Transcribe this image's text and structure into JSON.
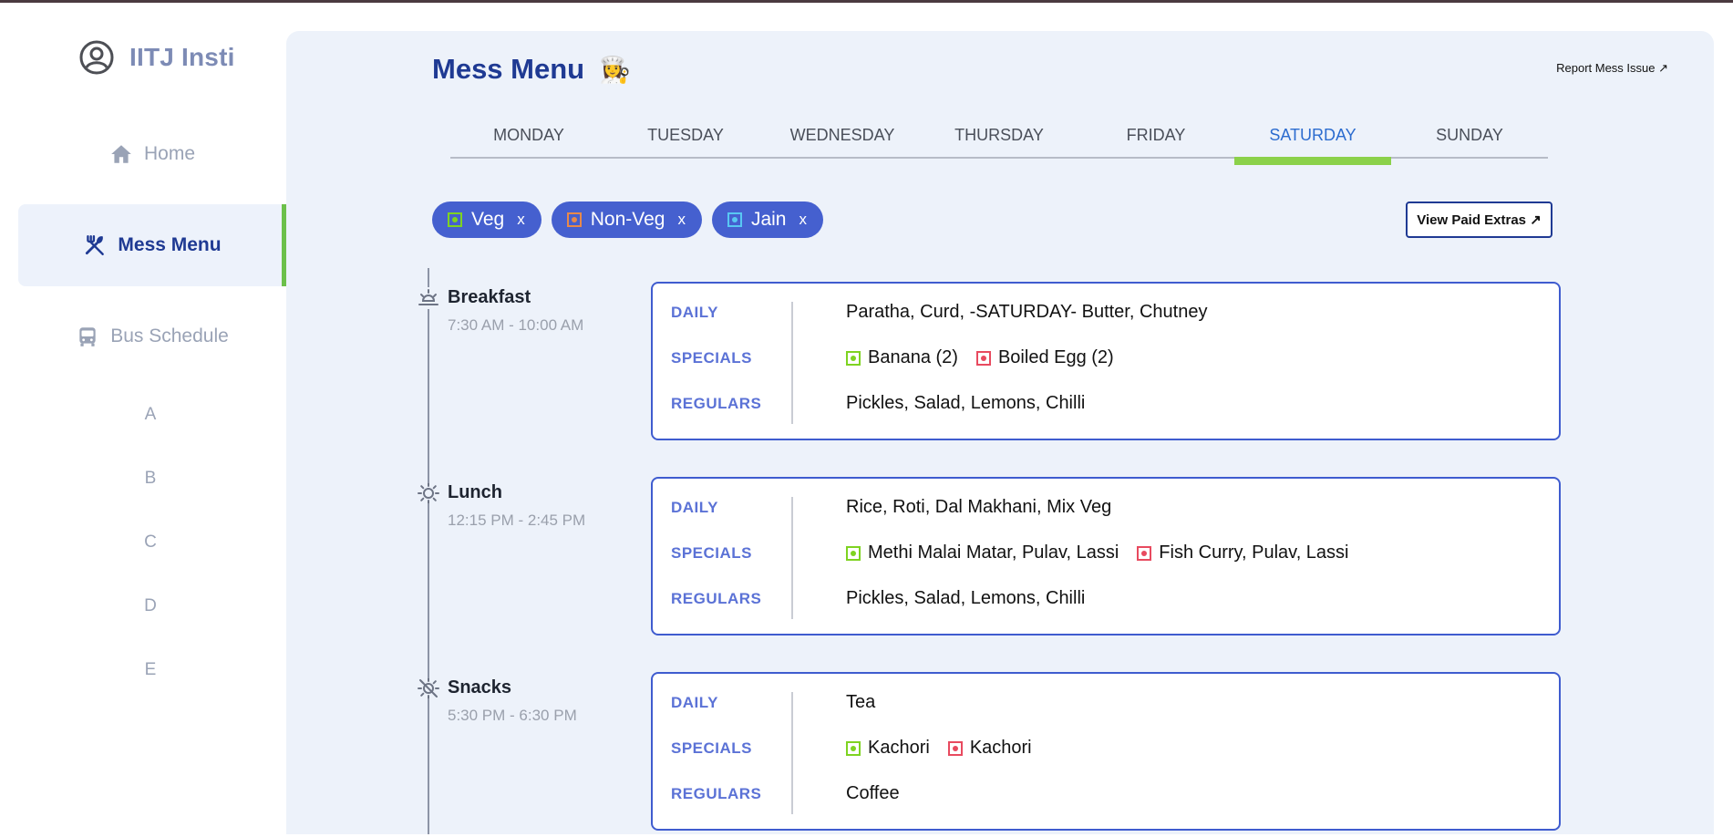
{
  "app": {
    "name": "IITJ Insti"
  },
  "sidebar": {
    "items": [
      {
        "label": "Home"
      },
      {
        "label": "Mess Menu"
      },
      {
        "label": "Bus Schedule"
      }
    ],
    "sub_items": [
      "A",
      "B",
      "C",
      "D",
      "E"
    ]
  },
  "page": {
    "title": "Mess Menu",
    "title_emoji": "👩‍🍳",
    "report_link": "Report Mess Issue ↗",
    "extras_button": "View Paid Extras ↗"
  },
  "tabs": [
    "MONDAY",
    "TUESDAY",
    "WEDNESDAY",
    "THURSDAY",
    "FRIDAY",
    "SATURDAY",
    "SUNDAY"
  ],
  "active_tab": "SATURDAY",
  "filters": [
    {
      "label": "Veg",
      "remove": "x",
      "color": "#7ed321"
    },
    {
      "label": "Non-Veg",
      "remove": "x",
      "color": "#e8894a"
    },
    {
      "label": "Jain",
      "remove": "x",
      "color": "#58c7f3"
    }
  ],
  "row_labels": {
    "daily": "DAILY",
    "specials": "SPECIALS",
    "regulars": "REGULARS"
  },
  "meals": [
    {
      "name": "Breakfast",
      "time": "7:30 AM - 10:00 AM",
      "icon": "sunrise-icon",
      "daily": "Paratha, Curd, -SATURDAY- Butter, Chutney",
      "specials_veg": "Banana (2)",
      "specials_nonveg": "Boiled Egg (2)",
      "regulars": "Pickles, Salad, Lemons, Chilli"
    },
    {
      "name": "Lunch",
      "time": "12:15 PM - 2:45 PM",
      "icon": "sun-icon",
      "daily": "Rice, Roti, Dal Makhani, Mix Veg",
      "specials_veg": "Methi Malai Matar, Pulav, Lassi",
      "specials_nonveg": "Fish Curry, Pulav, Lassi",
      "regulars": "Pickles, Salad, Lemons, Chilli"
    },
    {
      "name": "Snacks",
      "time": "5:30 PM - 6:30 PM",
      "icon": "sun-off-icon",
      "daily": "Tea",
      "specials_veg": "Kachori",
      "specials_nonveg": "Kachori",
      "regulars": "Coffee"
    }
  ],
  "colors": {
    "accent": "#1f3a93",
    "chip": "#4560cf",
    "active_tab": "#2c6ccf",
    "active_bar": "#8bd14a",
    "sidebar_active_bar": "#6cc04a"
  }
}
